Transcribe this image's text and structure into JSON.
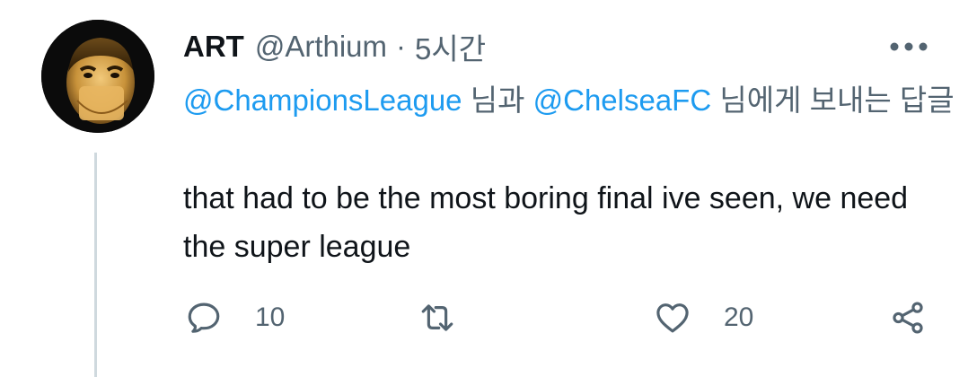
{
  "tweet": {
    "display_name": "ART",
    "handle": "@Arthium",
    "separator": "·",
    "time": "5시간",
    "reply_to": {
      "mention_1": "@ChampionsLeague",
      "conj_1": " 님과 ",
      "mention_2": "@ChelseaFC",
      "conj_2": " 님에게 보내는 답글"
    },
    "text": "that had to be the most boring final ive seen, we need the super league",
    "actions": {
      "reply_count": "10",
      "retweet_count": "",
      "like_count": "20"
    },
    "icons": {
      "avatar": "profile-avatar",
      "more": "more-horizontal-icon",
      "reply": "reply-icon",
      "retweet": "retweet-icon",
      "like": "heart-icon",
      "share": "share-icon"
    },
    "colors": {
      "link": "#1d9bf0",
      "secondary_text": "#536471",
      "primary_text": "#0f1419",
      "thread_line": "#cfd9de"
    }
  }
}
